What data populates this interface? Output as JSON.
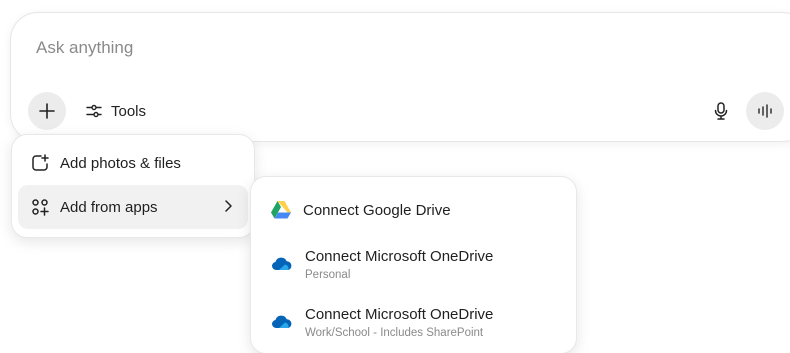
{
  "composer": {
    "placeholder": "Ask anything",
    "tools_label": "Tools",
    "icons": {
      "add": "plus-icon",
      "tools": "sliders-icon",
      "mic": "microphone-icon",
      "voice": "voice-waveform-icon"
    }
  },
  "menu": {
    "items": [
      {
        "label": "Add photos & files",
        "icon": "add-photo-icon"
      },
      {
        "label": "Add from apps",
        "icon": "apps-icon",
        "has_submenu": true
      }
    ]
  },
  "submenu": {
    "items": [
      {
        "title": "Connect Google Drive",
        "subtitle": "",
        "icon": "google-drive-icon"
      },
      {
        "title": "Connect Microsoft OneDrive",
        "subtitle": "Personal",
        "icon": "onedrive-icon"
      },
      {
        "title": "Connect Microsoft OneDrive",
        "subtitle": "Work/School - Includes SharePoint",
        "icon": "onedrive-icon"
      }
    ]
  },
  "colors": {
    "drive_green": "#1FA463",
    "drive_yellow": "#FFD04B",
    "drive_blue": "#4688F4",
    "onedrive_blue": "#0364B8",
    "onedrive_light": "#28A8EA"
  }
}
